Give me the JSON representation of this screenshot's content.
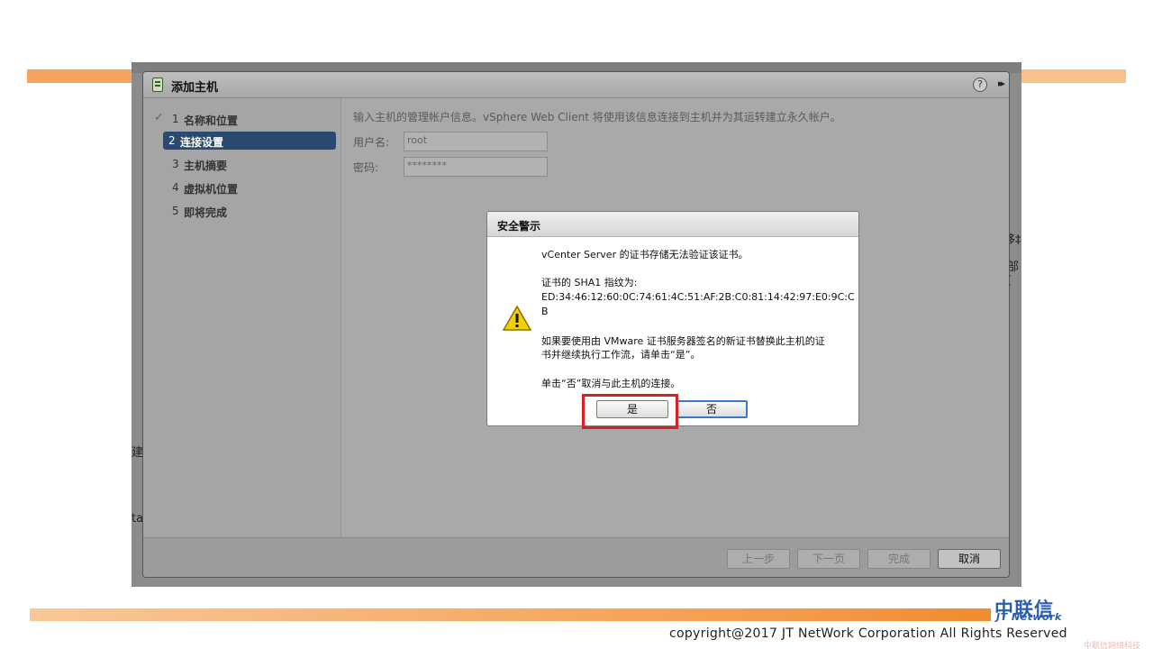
{
  "wizard": {
    "title": "添加主机",
    "help": "?",
    "expand": "▸▸",
    "steps": [
      {
        "num": "1",
        "label": "名称和位置",
        "state": "done"
      },
      {
        "num": "2",
        "label": "连接设置",
        "state": "active"
      },
      {
        "num": "3",
        "label": "主机摘要",
        "state": "pending"
      },
      {
        "num": "4",
        "label": "虚拟机位置",
        "state": "pending"
      },
      {
        "num": "5",
        "label": "即将完成",
        "state": "pending"
      }
    ],
    "description": "输入主机的管理帐户信息。vSphere Web Client 将使用该信息连接到主机并为其运转建立永久帐户。",
    "username_label": "用户名:",
    "username_value": "root",
    "password_label": "密码:",
    "password_value": "********",
    "buttons": {
      "back": "上一步",
      "next": "下一页",
      "finish": "完成",
      "cancel": "取消"
    }
  },
  "alert": {
    "title": "安全警示",
    "line1": "vCenter Server 的证书存储无法验证该证书。",
    "fingerprint_label": "证书的 SHA1 指纹为:",
    "fingerprint_line1": "ED:34:46:12:60:0C:74:61:4C:51:AF:2B:C0:81:14:42:97:E0:9C:C",
    "fingerprint_line2": "B",
    "instruction_line1": "如果要使用由 VMware 证书服务器签名的新证书替换此主机的证",
    "instruction_line2": "书并继续执行工作流，请单击“是”。",
    "cancel_hint": "单击“否”取消与此主机的连接。",
    "yes": "是",
    "no": "否"
  },
  "background_fragments": {
    "right_a": "移‡",
    "right_b": "部 (",
    "left_a": "建",
    "left_b": "tar"
  },
  "footer": {
    "logo_cn": "中联信",
    "logo_en": "JT Network",
    "copyright": "copyright@2017  JT NetWork Corporation All Rights Reserved",
    "watermark": "中联信网络科技"
  },
  "colors": {
    "accent_orange": "#f4a460",
    "active_step": "#2b4a72",
    "highlight_red": "#d92020",
    "logo_blue": "#2a5db0"
  }
}
